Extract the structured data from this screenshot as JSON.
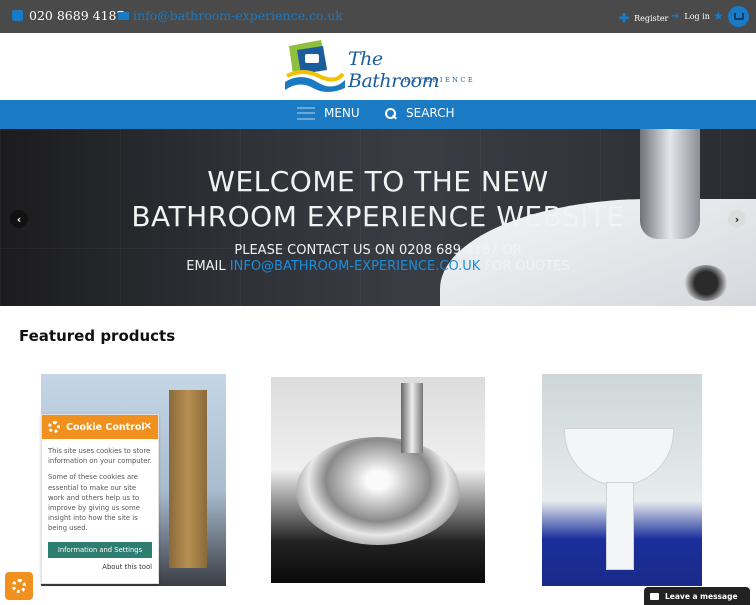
{
  "topbar": {
    "phone": "020 8689 4187",
    "email": "info@bathroom-experience.co.uk",
    "register_label": "Register",
    "login_label": "Log in"
  },
  "logo": {
    "title": "The Bathroom",
    "subtitle": "EXPERIENCE"
  },
  "nav": {
    "menu_label": "MENU",
    "search_label": "SEARCH"
  },
  "hero": {
    "headline_line1": "WELCOME TO THE NEW",
    "headline_line2": "BATHROOM EXPERIENCE WEBSITE",
    "contact_line1": "PLEASE CONTACT US ON 0208 689 4187 OR",
    "contact_prefix": "EMAIL",
    "contact_email": "INFO@BATHROOM-EXPERIENCE.CO.UK",
    "contact_suffix": "FOR QUOTES"
  },
  "featured": {
    "title": "Featured products"
  },
  "cookie": {
    "title": "Cookie Control",
    "close_symbol": "×",
    "text1": "This site uses cookies to store information on your computer.",
    "text2": "Some of these cookies are essential to make our site work and others help us to improve by giving us some insight into how the site is being used.",
    "button_label": "Information and Settings",
    "about_label": "About this tool"
  },
  "chat": {
    "label": "Leave a message"
  },
  "colors": {
    "brand_blue": "#1a7ac4",
    "topbar_bg": "#4a4a4a",
    "cookie_orange": "#f0901e",
    "cookie_button": "#2d7e70"
  },
  "icons": [
    "phone-icon",
    "mail-icon",
    "plus-icon",
    "login-icon",
    "star-icon",
    "cart-icon",
    "hamburger-icon",
    "search-icon",
    "arrow-left-icon",
    "arrow-right-icon",
    "gear-icon",
    "close-icon",
    "chat-icon"
  ]
}
